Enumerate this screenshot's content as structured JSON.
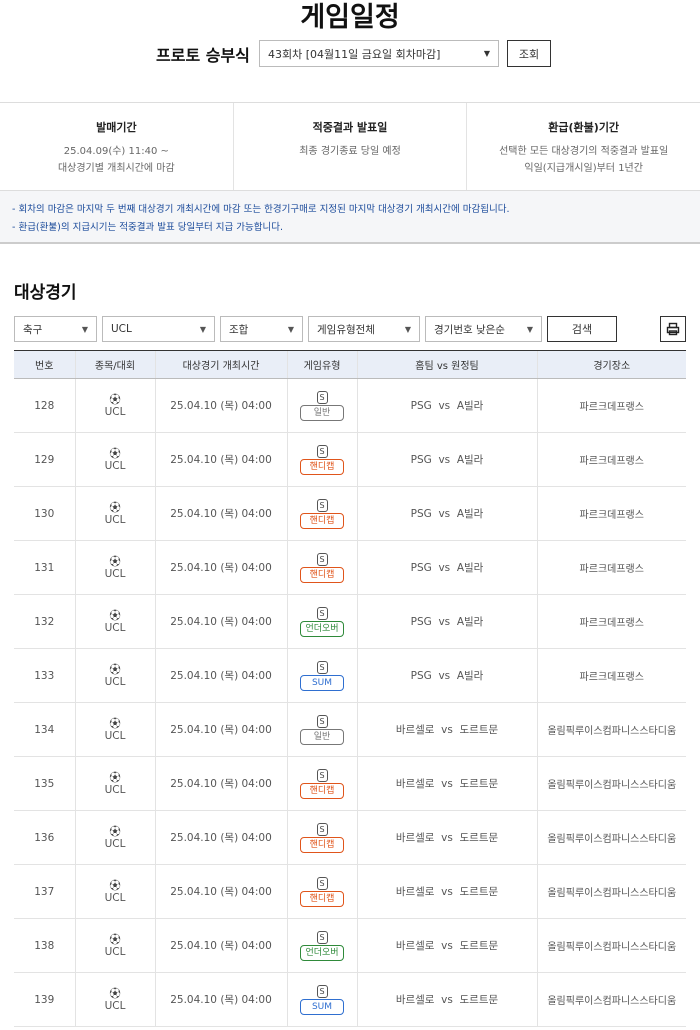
{
  "page_title": "게임일정",
  "round": {
    "label": "프로토 승부식",
    "selected": "43회차 [04월11일 금요일 회차마감]",
    "search_label": "조회"
  },
  "info": [
    {
      "title": "발매기간",
      "lines": [
        "25.04.09(수) 11:40 ~",
        "대상경기별 개최시간에 마감"
      ]
    },
    {
      "title": "적중결과 발표일",
      "lines": [
        "최종 경기종료 당일 예정"
      ]
    },
    {
      "title": "환급(환불)기간",
      "lines": [
        "선택한 모든 대상경기의 적중결과 발표일",
        "익일(지급개시일)부터 1년간"
      ]
    }
  ],
  "notes": [
    "- 회차의 마감은 마지막 두 번째 대상경기 개최시간에 마감 또는 한경기구매로 지정된 마지막 대상경기 개최시간에 마감됩니다.",
    "- 환급(환불)의 지급시기는 적중결과 발표 당일부터 지급 가능합니다."
  ],
  "section_title": "대상경기",
  "filters": [
    {
      "value": "축구",
      "w": 83
    },
    {
      "value": "UCL",
      "w": 113
    },
    {
      "value": "조합",
      "w": 83
    },
    {
      "value": "게임유형전체",
      "w": 112
    },
    {
      "value": "경기번호 낮은순",
      "w": 117
    }
  ],
  "search_button": "검색",
  "badge_colors": {
    "일반": "#777777",
    "핸디캡": "#e0551b",
    "언더오버": "#2f8a3a",
    "SUM": "#2f6fd0"
  },
  "table": {
    "headers": [
      "번호",
      "종목/대회",
      "대상경기 개최시간",
      "게임유형",
      "홈팀 vs 원정팀",
      "경기장소"
    ],
    "rows": [
      {
        "no": "128",
        "league": "UCL",
        "time": "25.04.10 (목) 04:00",
        "type": "일반",
        "match": "PSG  vs  A빌라",
        "venue": "파르크데프랭스"
      },
      {
        "no": "129",
        "league": "UCL",
        "time": "25.04.10 (목) 04:00",
        "type": "핸디캡",
        "match": "PSG  vs  A빌라",
        "venue": "파르크데프랭스"
      },
      {
        "no": "130",
        "league": "UCL",
        "time": "25.04.10 (목) 04:00",
        "type": "핸디캡",
        "match": "PSG  vs  A빌라",
        "venue": "파르크데프랭스"
      },
      {
        "no": "131",
        "league": "UCL",
        "time": "25.04.10 (목) 04:00",
        "type": "핸디캡",
        "match": "PSG  vs  A빌라",
        "venue": "파르크데프랭스"
      },
      {
        "no": "132",
        "league": "UCL",
        "time": "25.04.10 (목) 04:00",
        "type": "언더오버",
        "match": "PSG  vs  A빌라",
        "venue": "파르크데프랭스"
      },
      {
        "no": "133",
        "league": "UCL",
        "time": "25.04.10 (목) 04:00",
        "type": "SUM",
        "match": "PSG  vs  A빌라",
        "venue": "파르크데프랭스"
      },
      {
        "no": "134",
        "league": "UCL",
        "time": "25.04.10 (목) 04:00",
        "type": "일반",
        "match": "바르셀로  vs  도르트문",
        "venue": "올림픽루이스컴파니스스타디움"
      },
      {
        "no": "135",
        "league": "UCL",
        "time": "25.04.10 (목) 04:00",
        "type": "핸디캡",
        "match": "바르셀로  vs  도르트문",
        "venue": "올림픽루이스컴파니스스타디움"
      },
      {
        "no": "136",
        "league": "UCL",
        "time": "25.04.10 (목) 04:00",
        "type": "핸디캡",
        "match": "바르셀로  vs  도르트문",
        "venue": "올림픽루이스컴파니스스타디움"
      },
      {
        "no": "137",
        "league": "UCL",
        "time": "25.04.10 (목) 04:00",
        "type": "핸디캡",
        "match": "바르셀로  vs  도르트문",
        "venue": "올림픽루이스컴파니스스타디움"
      },
      {
        "no": "138",
        "league": "UCL",
        "time": "25.04.10 (목) 04:00",
        "type": "언더오버",
        "match": "바르셀로  vs  도르트문",
        "venue": "올림픽루이스컴파니스스타디움"
      },
      {
        "no": "139",
        "league": "UCL",
        "time": "25.04.10 (목) 04:00",
        "type": "SUM",
        "match": "바르셀로  vs  도르트문",
        "venue": "올림픽루이스컴파니스스타디움"
      }
    ],
    "s_icon": "S"
  }
}
